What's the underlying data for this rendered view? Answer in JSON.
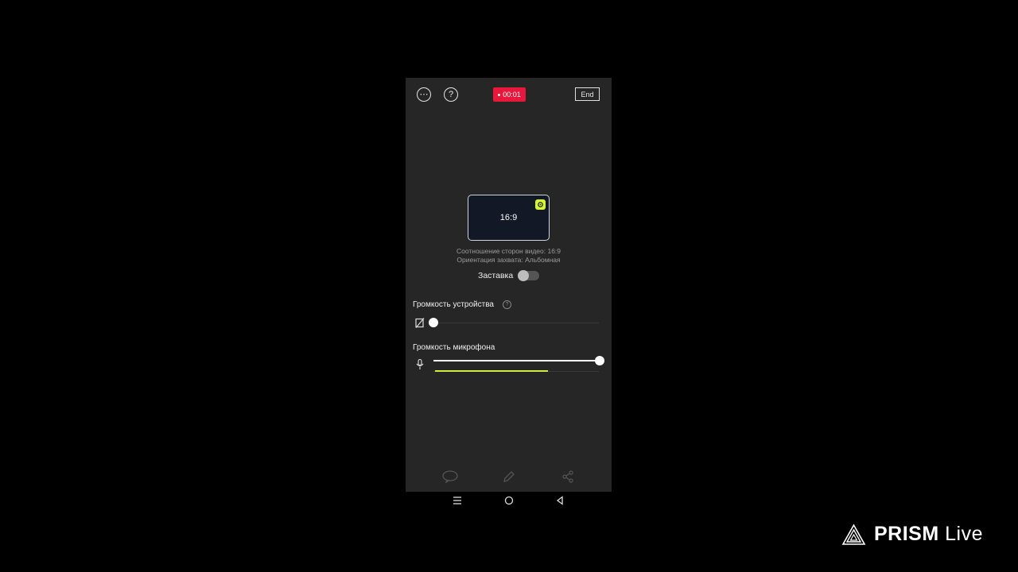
{
  "header": {
    "more_icon": "⋯",
    "help_icon": "?",
    "timer": "00:01",
    "end_label": "End"
  },
  "preview": {
    "aspect_ratio": "16:9",
    "settings_icon": "gear-icon",
    "line1": "Соотношение сторон видео: 16:9",
    "line2": "Ориентация захвата: Альбомная"
  },
  "screensaver": {
    "label": "Заставка",
    "enabled": false
  },
  "device_volume": {
    "label": "Громкость устройства",
    "level": 0.0
  },
  "mic_volume": {
    "label": "Громкость микрофона",
    "level": 1.0,
    "input_level": 0.68
  },
  "bottom_bar": [
    "chat-icon",
    "pen-icon",
    "share-icon"
  ],
  "nav": [
    "menu-icon",
    "home-icon",
    "back-icon"
  ],
  "brand": {
    "name_bold": "PRISM",
    "name_light": "Live"
  },
  "colors": {
    "record": "#e8173c",
    "accent": "#d8f531",
    "panel": "#262626"
  }
}
